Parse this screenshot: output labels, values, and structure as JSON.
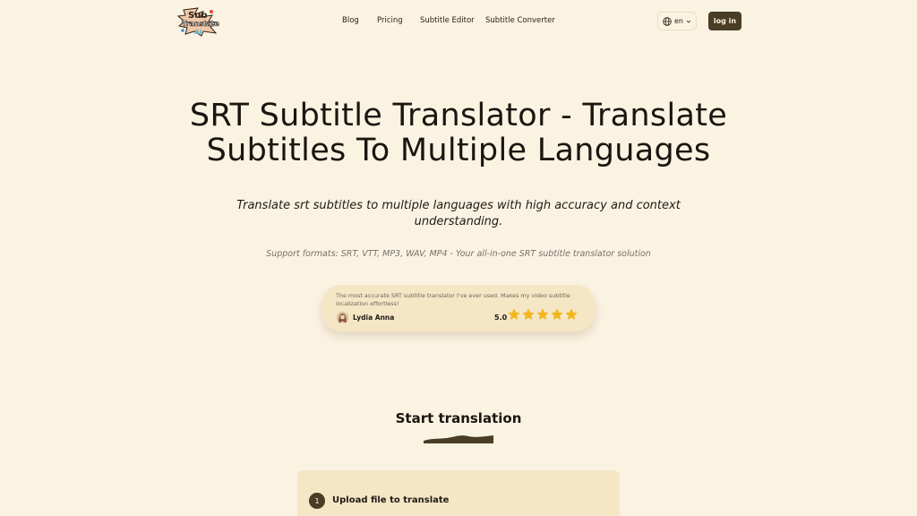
{
  "header": {
    "logo_text": "Sub Translate AI",
    "nav": [
      "Blog",
      "Pricing",
      "Subtitle Editor",
      "Subtitle Converter"
    ],
    "language": "en",
    "login_label": "log in"
  },
  "hero": {
    "title": "SRT Subtitle Translator - Translate Subtitles To Multiple Languages",
    "subtitle": "Translate srt subtitles to multiple languages with high accuracy and context understanding.",
    "formats": "Support formats: SRT, VTT, MP3, WAV, MP4 - Your all-in-one SRT subtitle translator solution"
  },
  "review": {
    "quote": "The most accurate SRT subtitle translator I've ever used. Makes my video subtitle localization effortless!",
    "name": "Lydia Anna",
    "rating": "5.0",
    "stars": 5
  },
  "start": {
    "title": "Start translation",
    "step_number": "1",
    "step_label": "Upload file to translate"
  },
  "colors": {
    "background": "#fbf3e2",
    "card": "#f5e6c6",
    "accent": "#4a3d26",
    "star": "#f2b71f"
  }
}
